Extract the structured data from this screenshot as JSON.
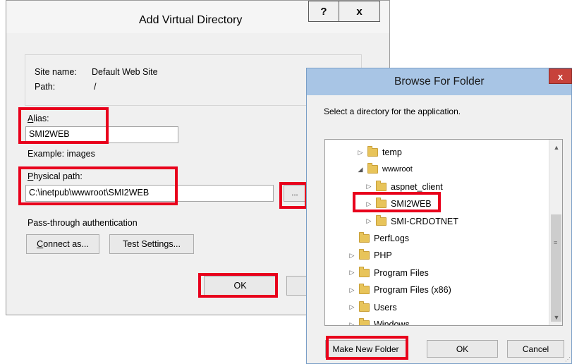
{
  "add_virtual_directory": {
    "title": "Add Virtual Directory",
    "help_label": "?",
    "close_label": "x",
    "site_name_label": "Site name:",
    "site_name_value": "Default Web Site",
    "path_label": "Path:",
    "path_value": "/",
    "alias_label_accel": "A",
    "alias_label_rest": "lias:",
    "alias_value": "SMI2WEB",
    "example_text": "Example: images",
    "physical_path_label_accel": "P",
    "physical_path_label_rest": "hysical path:",
    "physical_path_value": "C:\\inetpub\\wwwroot\\SMI2WEB",
    "browse_button_label": "...",
    "pass_through_label": "Pass-through authentication",
    "connect_as_accel": "C",
    "connect_as_rest": "onnect as...",
    "test_settings_label": "Test Settings...",
    "ok_label": "OK"
  },
  "browse_for_folder": {
    "title": "Browse For Folder",
    "close_label": "x",
    "instruction": "Select a directory for the application.",
    "tree": [
      {
        "label": "temp",
        "expander": "collapsed",
        "level": 1
      },
      {
        "label": "wwwroot",
        "expander": "expanded",
        "level": 1
      },
      {
        "label": "aspnet_client",
        "expander": "collapsed",
        "level": 2
      },
      {
        "label": "SMI2WEB",
        "expander": "collapsed",
        "level": 2,
        "selected": true
      },
      {
        "label": "SMI-CRDOTNET",
        "expander": "collapsed",
        "level": 2
      },
      {
        "label": "PerfLogs",
        "expander": "none",
        "level": 0
      },
      {
        "label": "PHP",
        "expander": "collapsed",
        "level": 0
      },
      {
        "label": "Program Files",
        "expander": "collapsed",
        "level": 0
      },
      {
        "label": "Program Files (x86)",
        "expander": "collapsed",
        "level": 0
      },
      {
        "label": "Users",
        "expander": "collapsed",
        "level": 0
      },
      {
        "label": "Windows",
        "expander": "collapsed",
        "level": 0
      }
    ],
    "make_new_folder_label": "Make New Folder",
    "ok_label": "OK",
    "cancel_label": "Cancel"
  },
  "colors": {
    "highlight_box": "#e8001c",
    "title_bar_active": "#a8c5e5",
    "close_red": "#c7423b"
  }
}
